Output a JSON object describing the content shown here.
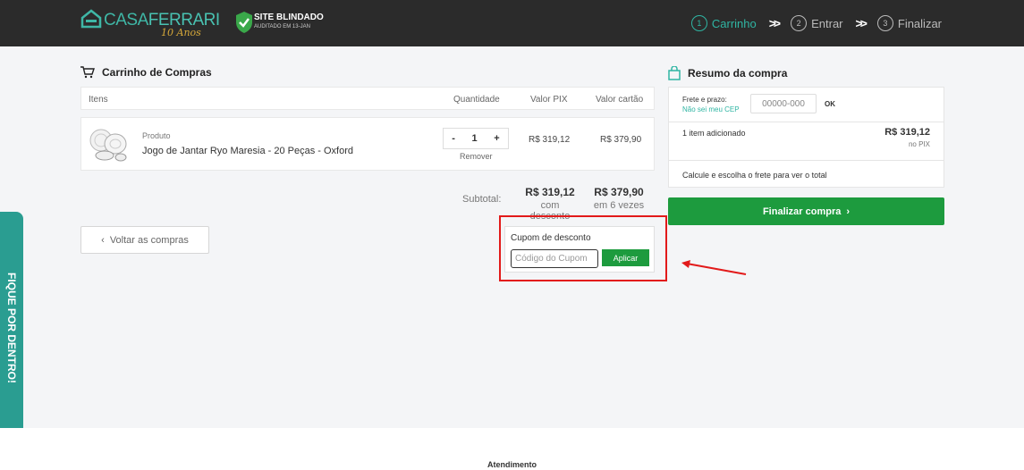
{
  "header": {
    "logo_text_a": "CASA",
    "logo_text_b": "FERRARI",
    "logo_sub": "10 Anos",
    "seal_title": "SITE BLINDADO",
    "seal_sub": "AUDITADO EM 13-JAN",
    "steps": [
      {
        "num": "1",
        "label": "Carrinho",
        "active": true
      },
      {
        "num": "2",
        "label": "Entrar",
        "active": false
      },
      {
        "num": "3",
        "label": "Finalizar",
        "active": false
      }
    ]
  },
  "cart": {
    "title": "Carrinho de Compras",
    "columns": {
      "items": "Itens",
      "qty": "Quantidade",
      "pix": "Valor PIX",
      "card": "Valor cartão"
    },
    "item": {
      "kind": "Produto",
      "name": "Jogo de Jantar Ryo Maresia - 20 Peças - Oxford",
      "qty": "1",
      "minus": "-",
      "plus": "+",
      "remove": "Remover",
      "price_pix": "R$ 319,12",
      "price_card": "R$ 379,90"
    },
    "subtotal_label": "Subtotal:",
    "subtotal_pix": "R$ 319,12",
    "subtotal_pix_note": "com desconto",
    "subtotal_card": "R$ 379,90",
    "subtotal_card_note": "em 6 vezes",
    "back_label": "Voltar as compras"
  },
  "coupon": {
    "label": "Cupom de desconto",
    "placeholder": "Código do Cupom",
    "apply": "Aplicar"
  },
  "summary": {
    "title": "Resumo da compra",
    "frete_label": "Frete e prazo:",
    "cep_link": "Não sei meu CEP",
    "cep_placeholder": "00000-000",
    "ok": "OK",
    "items_added": "1 item adicionado",
    "total": "R$ 319,12",
    "total_note": "no PIX",
    "frete_note": "Calcule e escolha o frete para ver o total",
    "finalize": "Finalizar compra"
  },
  "side_tab": "FIQUE POR DENTRO!",
  "footer": {
    "title": "Atendimento"
  },
  "colors": {
    "brand": "#2fb5a3",
    "green_button": "#1d9b3e",
    "highlight": "#e21a1a",
    "header_bg": "#2b2b2b"
  }
}
